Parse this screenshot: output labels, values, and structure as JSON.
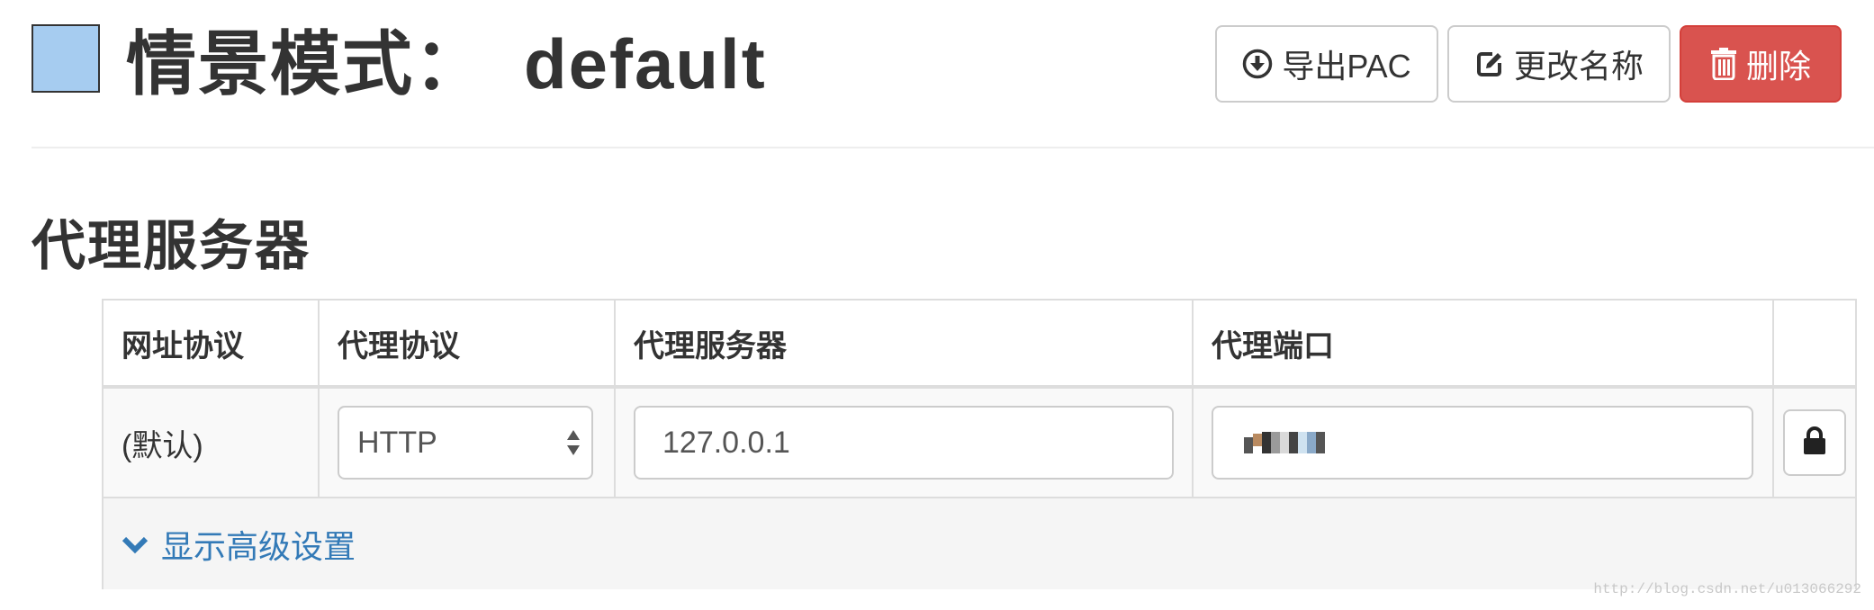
{
  "header": {
    "title_prefix": "情景模式：",
    "profile_name": "default",
    "swatch_color": "#a6ccf0",
    "buttons": {
      "export_label": "导出PAC",
      "export_icon": "download-circle-icon",
      "rename_label": "更改名称",
      "rename_icon": "edit-icon",
      "delete_label": "删除",
      "delete_icon": "trash-icon",
      "delete_color": "#d9534f"
    }
  },
  "section": {
    "title": "代理服务器"
  },
  "table": {
    "headers": [
      "网址协议",
      "代理协议",
      "代理服务器",
      "代理端口"
    ],
    "row": {
      "scheme": "(默认)",
      "protocol": "HTTP",
      "host": "127.0.0.1",
      "port": "",
      "lock_icon": "lock-icon"
    },
    "advanced_link": "显示高级设置",
    "advanced_icon": "chevron-down-icon",
    "link_color": "#337ab7"
  },
  "watermark": "http://blog.csdn.net/u013066292"
}
